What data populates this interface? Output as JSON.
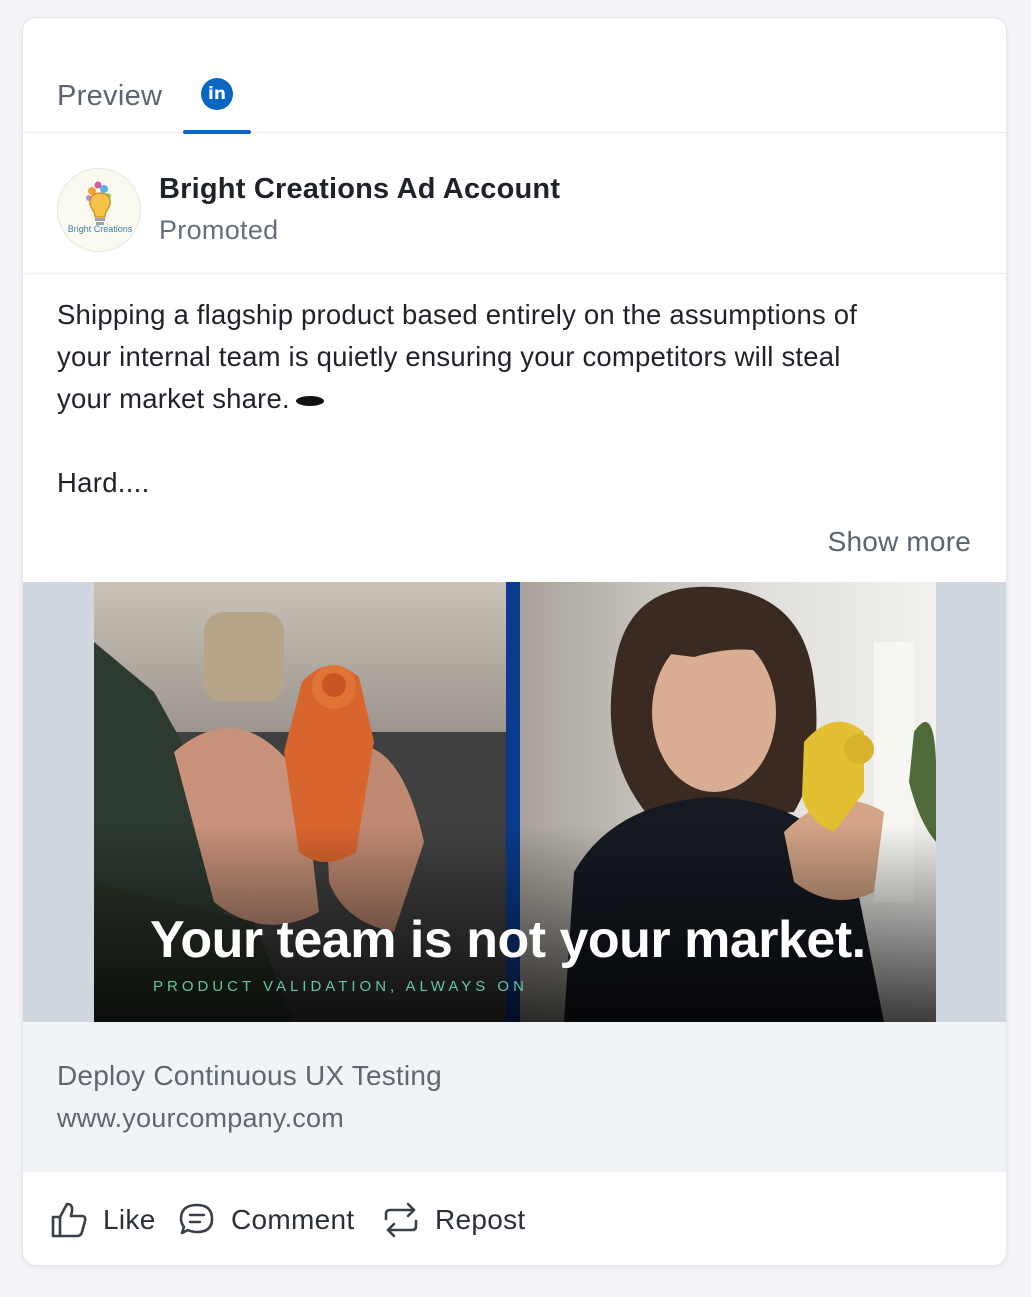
{
  "tabs": {
    "preview_label": "Preview",
    "linkedin_badge": "in"
  },
  "post": {
    "account_name": "Bright Creations Ad Account",
    "sponsored_label": "Promoted",
    "avatar_logo_text": "Bright Creations",
    "text_lines": [
      "Shipping a flagship product based entirely on the assumptions of",
      "your internal team is quietly ensuring your competitors will steal",
      "your market share."
    ],
    "text_more": "Hard....",
    "show_more_label": "Show more"
  },
  "media": {
    "headline": "Your team is not your market.",
    "tagline": "PRODUCT VALIDATION, ALWAYS ON"
  },
  "link": {
    "title": "Deploy Continuous UX Testing",
    "url": "www.yourcompany.com"
  },
  "actions": {
    "like_label": "Like",
    "comment_label": "Comment",
    "repost_label": "Repost"
  },
  "colors": {
    "linkedin_blue": "#0a66c2",
    "tagline_green": "#5fc7a4",
    "link_area_bg": "#f1f4f7"
  }
}
